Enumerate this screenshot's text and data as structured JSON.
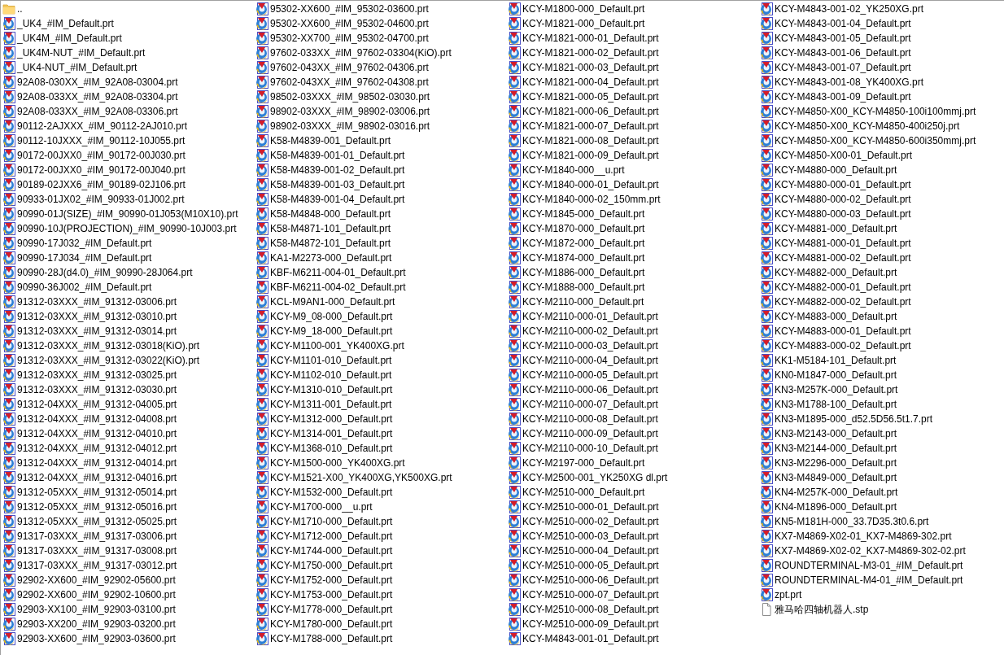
{
  "files": [
    {
      "name": "..",
      "kind": "folder"
    },
    {
      "name": "_UK4_#IM_Default.prt",
      "kind": "prt"
    },
    {
      "name": "_UK4M_#IM_Default.prt",
      "kind": "prt"
    },
    {
      "name": "_UK4M-NUT_#IM_Default.prt",
      "kind": "prt"
    },
    {
      "name": "_UK4-NUT_#IM_Default.prt",
      "kind": "prt"
    },
    {
      "name": "92A08-030XX_#IM_92A08-03004.prt",
      "kind": "prt"
    },
    {
      "name": "92A08-033XX_#IM_92A08-03304.prt",
      "kind": "prt"
    },
    {
      "name": "92A08-033XX_#IM_92A08-03306.prt",
      "kind": "prt"
    },
    {
      "name": "90112-2AJXXX_#IM_90112-2AJ010.prt",
      "kind": "prt"
    },
    {
      "name": "90112-10JXXX_#IM_90112-10J055.prt",
      "kind": "prt"
    },
    {
      "name": "90172-00JXX0_#IM_90172-00J030.prt",
      "kind": "prt"
    },
    {
      "name": "90172-00JXX0_#IM_90172-00J040.prt",
      "kind": "prt"
    },
    {
      "name": "90189-02JXX6_#IM_90189-02J106.prt",
      "kind": "prt"
    },
    {
      "name": "90933-01JX02_#IM_90933-01J002.prt",
      "kind": "prt"
    },
    {
      "name": "90990-01J(SIZE)_#IM_90990-01J053(M10X10).prt",
      "kind": "prt"
    },
    {
      "name": "90990-10J(PROJECTION)_#IM_90990-10J003.prt",
      "kind": "prt"
    },
    {
      "name": "90990-17J032_#IM_Default.prt",
      "kind": "prt"
    },
    {
      "name": "90990-17J034_#IM_Default.prt",
      "kind": "prt"
    },
    {
      "name": "90990-28J(d4.0)_#IM_90990-28J064.prt",
      "kind": "prt"
    },
    {
      "name": "90990-36J002_#IM_Default.prt",
      "kind": "prt"
    },
    {
      "name": "91312-03XXX_#IM_91312-03006.prt",
      "kind": "prt"
    },
    {
      "name": "91312-03XXX_#IM_91312-03010.prt",
      "kind": "prt"
    },
    {
      "name": "91312-03XXX_#IM_91312-03014.prt",
      "kind": "prt"
    },
    {
      "name": "91312-03XXX_#IM_91312-03018(KiO).prt",
      "kind": "prt"
    },
    {
      "name": "91312-03XXX_#IM_91312-03022(KiO).prt",
      "kind": "prt"
    },
    {
      "name": "91312-03XXX_#IM_91312-03025.prt",
      "kind": "prt"
    },
    {
      "name": "91312-03XXX_#IM_91312-03030.prt",
      "kind": "prt"
    },
    {
      "name": "91312-04XXX_#IM_91312-04005.prt",
      "kind": "prt"
    },
    {
      "name": "91312-04XXX_#IM_91312-04008.prt",
      "kind": "prt"
    },
    {
      "name": "91312-04XXX_#IM_91312-04010.prt",
      "kind": "prt"
    },
    {
      "name": "91312-04XXX_#IM_91312-04012.prt",
      "kind": "prt"
    },
    {
      "name": "91312-04XXX_#IM_91312-04014.prt",
      "kind": "prt"
    },
    {
      "name": "91312-04XXX_#IM_91312-04016.prt",
      "kind": "prt"
    },
    {
      "name": "91312-05XXX_#IM_91312-05014.prt",
      "kind": "prt"
    },
    {
      "name": "91312-05XXX_#IM_91312-05016.prt",
      "kind": "prt"
    },
    {
      "name": "91312-05XXX_#IM_91312-05025.prt",
      "kind": "prt"
    },
    {
      "name": "91317-03XXX_#IM_91317-03006.prt",
      "kind": "prt"
    },
    {
      "name": "91317-03XXX_#IM_91317-03008.prt",
      "kind": "prt"
    },
    {
      "name": "91317-03XXX_#IM_91317-03012.prt",
      "kind": "prt"
    },
    {
      "name": "92902-XX600_#IM_92902-05600.prt",
      "kind": "prt"
    },
    {
      "name": "92902-XX600_#IM_92902-10600.prt",
      "kind": "prt"
    },
    {
      "name": "92903-XX100_#IM_92903-03100.prt",
      "kind": "prt"
    },
    {
      "name": "92903-XX200_#IM_92903-03200.prt",
      "kind": "prt"
    },
    {
      "name": "92903-XX600_#IM_92903-03600.prt",
      "kind": "prt"
    },
    {
      "name": "95302-XX600_#IM_95302-03600.prt",
      "kind": "prt"
    },
    {
      "name": "95302-XX600_#IM_95302-04600.prt",
      "kind": "prt"
    },
    {
      "name": "95302-XX700_#IM_95302-04700.prt",
      "kind": "prt"
    },
    {
      "name": "97602-033XX_#IM_97602-03304(KiO).prt",
      "kind": "prt"
    },
    {
      "name": "97602-043XX_#IM_97602-04306.prt",
      "kind": "prt"
    },
    {
      "name": "97602-043XX_#IM_97602-04308.prt",
      "kind": "prt"
    },
    {
      "name": "98502-03XXX_#IM_98502-03030.prt",
      "kind": "prt"
    },
    {
      "name": "98902-03XXX_#IM_98902-03006.prt",
      "kind": "prt"
    },
    {
      "name": "98902-03XXX_#IM_98902-03016.prt",
      "kind": "prt"
    },
    {
      "name": "K58-M4839-001_Default.prt",
      "kind": "prt"
    },
    {
      "name": "K58-M4839-001-01_Default.prt",
      "kind": "prt"
    },
    {
      "name": "K58-M4839-001-02_Default.prt",
      "kind": "prt"
    },
    {
      "name": "K58-M4839-001-03_Default.prt",
      "kind": "prt"
    },
    {
      "name": "K58-M4839-001-04_Default.prt",
      "kind": "prt"
    },
    {
      "name": "K58-M4848-000_Default.prt",
      "kind": "prt"
    },
    {
      "name": "K58-M4871-101_Default.prt",
      "kind": "prt"
    },
    {
      "name": "K58-M4872-101_Default.prt",
      "kind": "prt"
    },
    {
      "name": "KA1-M2273-000_Default.prt",
      "kind": "prt"
    },
    {
      "name": "KBF-M6211-004-01_Default.prt",
      "kind": "prt"
    },
    {
      "name": "KBF-M6211-004-02_Default.prt",
      "kind": "prt"
    },
    {
      "name": "KCL-M9AN1-000_Default.prt",
      "kind": "prt"
    },
    {
      "name": "KCY-M9_08-000_Default.prt",
      "kind": "prt"
    },
    {
      "name": "KCY-M9_18-000_Default.prt",
      "kind": "prt"
    },
    {
      "name": "KCY-M1100-001_YK400XG.prt",
      "kind": "prt"
    },
    {
      "name": "KCY-M1101-010_Default.prt",
      "kind": "prt"
    },
    {
      "name": "KCY-M1102-010_Default.prt",
      "kind": "prt"
    },
    {
      "name": "KCY-M1310-010_Default.prt",
      "kind": "prt"
    },
    {
      "name": "KCY-M1311-001_Default.prt",
      "kind": "prt"
    },
    {
      "name": "KCY-M1312-000_Default.prt",
      "kind": "prt"
    },
    {
      "name": "KCY-M1314-001_Default.prt",
      "kind": "prt"
    },
    {
      "name": "KCY-M1368-010_Default.prt",
      "kind": "prt"
    },
    {
      "name": "KCY-M1500-000_YK400XG.prt",
      "kind": "prt"
    },
    {
      "name": "KCY-M1521-X00_YK400XG,YK500XG.prt",
      "kind": "prt"
    },
    {
      "name": "KCY-M1532-000_Default.prt",
      "kind": "prt"
    },
    {
      "name": "KCY-M1700-000__u.prt",
      "kind": "prt"
    },
    {
      "name": "KCY-M1710-000_Default.prt",
      "kind": "prt"
    },
    {
      "name": "KCY-M1712-000_Default.prt",
      "kind": "prt"
    },
    {
      "name": "KCY-M1744-000_Default.prt",
      "kind": "prt"
    },
    {
      "name": "KCY-M1750-000_Default.prt",
      "kind": "prt"
    },
    {
      "name": "KCY-M1752-000_Default.prt",
      "kind": "prt"
    },
    {
      "name": "KCY-M1753-000_Default.prt",
      "kind": "prt"
    },
    {
      "name": "KCY-M1778-000_Default.prt",
      "kind": "prt"
    },
    {
      "name": "KCY-M1780-000_Default.prt",
      "kind": "prt"
    },
    {
      "name": "KCY-M1788-000_Default.prt",
      "kind": "prt"
    },
    {
      "name": "KCY-M1800-000_Default.prt",
      "kind": "prt"
    },
    {
      "name": "KCY-M1821-000_Default.prt",
      "kind": "prt"
    },
    {
      "name": "KCY-M1821-000-01_Default.prt",
      "kind": "prt"
    },
    {
      "name": "KCY-M1821-000-02_Default.prt",
      "kind": "prt"
    },
    {
      "name": "KCY-M1821-000-03_Default.prt",
      "kind": "prt"
    },
    {
      "name": "KCY-M1821-000-04_Default.prt",
      "kind": "prt"
    },
    {
      "name": "KCY-M1821-000-05_Default.prt",
      "kind": "prt"
    },
    {
      "name": "KCY-M1821-000-06_Default.prt",
      "kind": "prt"
    },
    {
      "name": "KCY-M1821-000-07_Default.prt",
      "kind": "prt"
    },
    {
      "name": "KCY-M1821-000-08_Default.prt",
      "kind": "prt"
    },
    {
      "name": "KCY-M1821-000-09_Default.prt",
      "kind": "prt"
    },
    {
      "name": "KCY-M1840-000__u.prt",
      "kind": "prt"
    },
    {
      "name": "KCY-M1840-000-01_Default.prt",
      "kind": "prt"
    },
    {
      "name": "KCY-M1840-000-02_150mm.prt",
      "kind": "prt"
    },
    {
      "name": "KCY-M1845-000_Default.prt",
      "kind": "prt"
    },
    {
      "name": "KCY-M1870-000_Default.prt",
      "kind": "prt"
    },
    {
      "name": "KCY-M1872-000_Default.prt",
      "kind": "prt"
    },
    {
      "name": "KCY-M1874-000_Default.prt",
      "kind": "prt"
    },
    {
      "name": "KCY-M1886-000_Default.prt",
      "kind": "prt"
    },
    {
      "name": "KCY-M1888-000_Default.prt",
      "kind": "prt"
    },
    {
      "name": "KCY-M2110-000_Default.prt",
      "kind": "prt"
    },
    {
      "name": "KCY-M2110-000-01_Default.prt",
      "kind": "prt"
    },
    {
      "name": "KCY-M2110-000-02_Default.prt",
      "kind": "prt"
    },
    {
      "name": "KCY-M2110-000-03_Default.prt",
      "kind": "prt"
    },
    {
      "name": "KCY-M2110-000-04_Default.prt",
      "kind": "prt"
    },
    {
      "name": "KCY-M2110-000-05_Default.prt",
      "kind": "prt"
    },
    {
      "name": "KCY-M2110-000-06_Default.prt",
      "kind": "prt"
    },
    {
      "name": "KCY-M2110-000-07_Default.prt",
      "kind": "prt"
    },
    {
      "name": "KCY-M2110-000-08_Default.prt",
      "kind": "prt"
    },
    {
      "name": "KCY-M2110-000-09_Default.prt",
      "kind": "prt"
    },
    {
      "name": "KCY-M2110-000-10_Default.prt",
      "kind": "prt"
    },
    {
      "name": "KCY-M2197-000_Default.prt",
      "kind": "prt"
    },
    {
      "name": "KCY-M2500-001_YK250XG dl.prt",
      "kind": "prt"
    },
    {
      "name": "KCY-M2510-000_Default.prt",
      "kind": "prt"
    },
    {
      "name": "KCY-M2510-000-01_Default.prt",
      "kind": "prt"
    },
    {
      "name": "KCY-M2510-000-02_Default.prt",
      "kind": "prt"
    },
    {
      "name": "KCY-M2510-000-03_Default.prt",
      "kind": "prt"
    },
    {
      "name": "KCY-M2510-000-04_Default.prt",
      "kind": "prt"
    },
    {
      "name": "KCY-M2510-000-05_Default.prt",
      "kind": "prt"
    },
    {
      "name": "KCY-M2510-000-06_Default.prt",
      "kind": "prt"
    },
    {
      "name": "KCY-M2510-000-07_Default.prt",
      "kind": "prt"
    },
    {
      "name": "KCY-M2510-000-08_Default.prt",
      "kind": "prt"
    },
    {
      "name": "KCY-M2510-000-09_Default.prt",
      "kind": "prt"
    },
    {
      "name": "KCY-M4843-001-01_Default.prt",
      "kind": "prt"
    },
    {
      "name": "KCY-M4843-001-02_YK250XG.prt",
      "kind": "prt"
    },
    {
      "name": "KCY-M4843-001-04_Default.prt",
      "kind": "prt"
    },
    {
      "name": "KCY-M4843-001-05_Default.prt",
      "kind": "prt"
    },
    {
      "name": "KCY-M4843-001-06_Default.prt",
      "kind": "prt"
    },
    {
      "name": "KCY-M4843-001-07_Default.prt",
      "kind": "prt"
    },
    {
      "name": "KCY-M4843-001-08_YK400XG.prt",
      "kind": "prt"
    },
    {
      "name": "KCY-M4843-001-09_Default.prt",
      "kind": "prt"
    },
    {
      "name": "KCY-M4850-X00_KCY-M4850-100i100mmj.prt",
      "kind": "prt"
    },
    {
      "name": "KCY-M4850-X00_KCY-M4850-400i250j.prt",
      "kind": "prt"
    },
    {
      "name": "KCY-M4850-X00_KCY-M4850-600i350mmj.prt",
      "kind": "prt"
    },
    {
      "name": "KCY-M4850-X00-01_Default.prt",
      "kind": "prt"
    },
    {
      "name": "KCY-M4880-000_Default.prt",
      "kind": "prt"
    },
    {
      "name": "KCY-M4880-000-01_Default.prt",
      "kind": "prt"
    },
    {
      "name": "KCY-M4880-000-02_Default.prt",
      "kind": "prt"
    },
    {
      "name": "KCY-M4880-000-03_Default.prt",
      "kind": "prt"
    },
    {
      "name": "KCY-M4881-000_Default.prt",
      "kind": "prt"
    },
    {
      "name": "KCY-M4881-000-01_Default.prt",
      "kind": "prt"
    },
    {
      "name": "KCY-M4881-000-02_Default.prt",
      "kind": "prt"
    },
    {
      "name": "KCY-M4882-000_Default.prt",
      "kind": "prt"
    },
    {
      "name": "KCY-M4882-000-01_Default.prt",
      "kind": "prt"
    },
    {
      "name": "KCY-M4882-000-02_Default.prt",
      "kind": "prt"
    },
    {
      "name": "KCY-M4883-000_Default.prt",
      "kind": "prt"
    },
    {
      "name": "KCY-M4883-000-01_Default.prt",
      "kind": "prt"
    },
    {
      "name": "KCY-M4883-000-02_Default.prt",
      "kind": "prt"
    },
    {
      "name": "KK1-M5184-101_Default.prt",
      "kind": "prt"
    },
    {
      "name": "KN0-M1847-000_Default.prt",
      "kind": "prt"
    },
    {
      "name": "KN3-M257K-000_Default.prt",
      "kind": "prt"
    },
    {
      "name": "KN3-M1788-100_Default.prt",
      "kind": "prt"
    },
    {
      "name": "KN3-M1895-000_d52.5D56.5t1.7.prt",
      "kind": "prt"
    },
    {
      "name": "KN3-M2143-000_Default.prt",
      "kind": "prt"
    },
    {
      "name": "KN3-M2144-000_Default.prt",
      "kind": "prt"
    },
    {
      "name": "KN3-M2296-000_Default.prt",
      "kind": "prt"
    },
    {
      "name": "KN3-M4849-000_Default.prt",
      "kind": "prt"
    },
    {
      "name": "KN4-M257K-000_Default.prt",
      "kind": "prt"
    },
    {
      "name": "KN4-M1896-000_Default.prt",
      "kind": "prt"
    },
    {
      "name": "KN5-M181H-000_33.7D35.3t0.6.prt",
      "kind": "prt"
    },
    {
      "name": "KX7-M4869-X02-01_KX7-M4869-302.prt",
      "kind": "prt"
    },
    {
      "name": "KX7-M4869-X02-02_KX7-M4869-302-02.prt",
      "kind": "prt"
    },
    {
      "name": "ROUNDTERMINAL-M3-01_#IM_Default.prt",
      "kind": "prt"
    },
    {
      "name": "ROUNDTERMINAL-M4-01_#IM_Default.prt",
      "kind": "prt"
    },
    {
      "name": "zpt.prt",
      "kind": "prt"
    },
    {
      "name": "雅马哈四轴机器人.stp",
      "kind": "file"
    }
  ]
}
